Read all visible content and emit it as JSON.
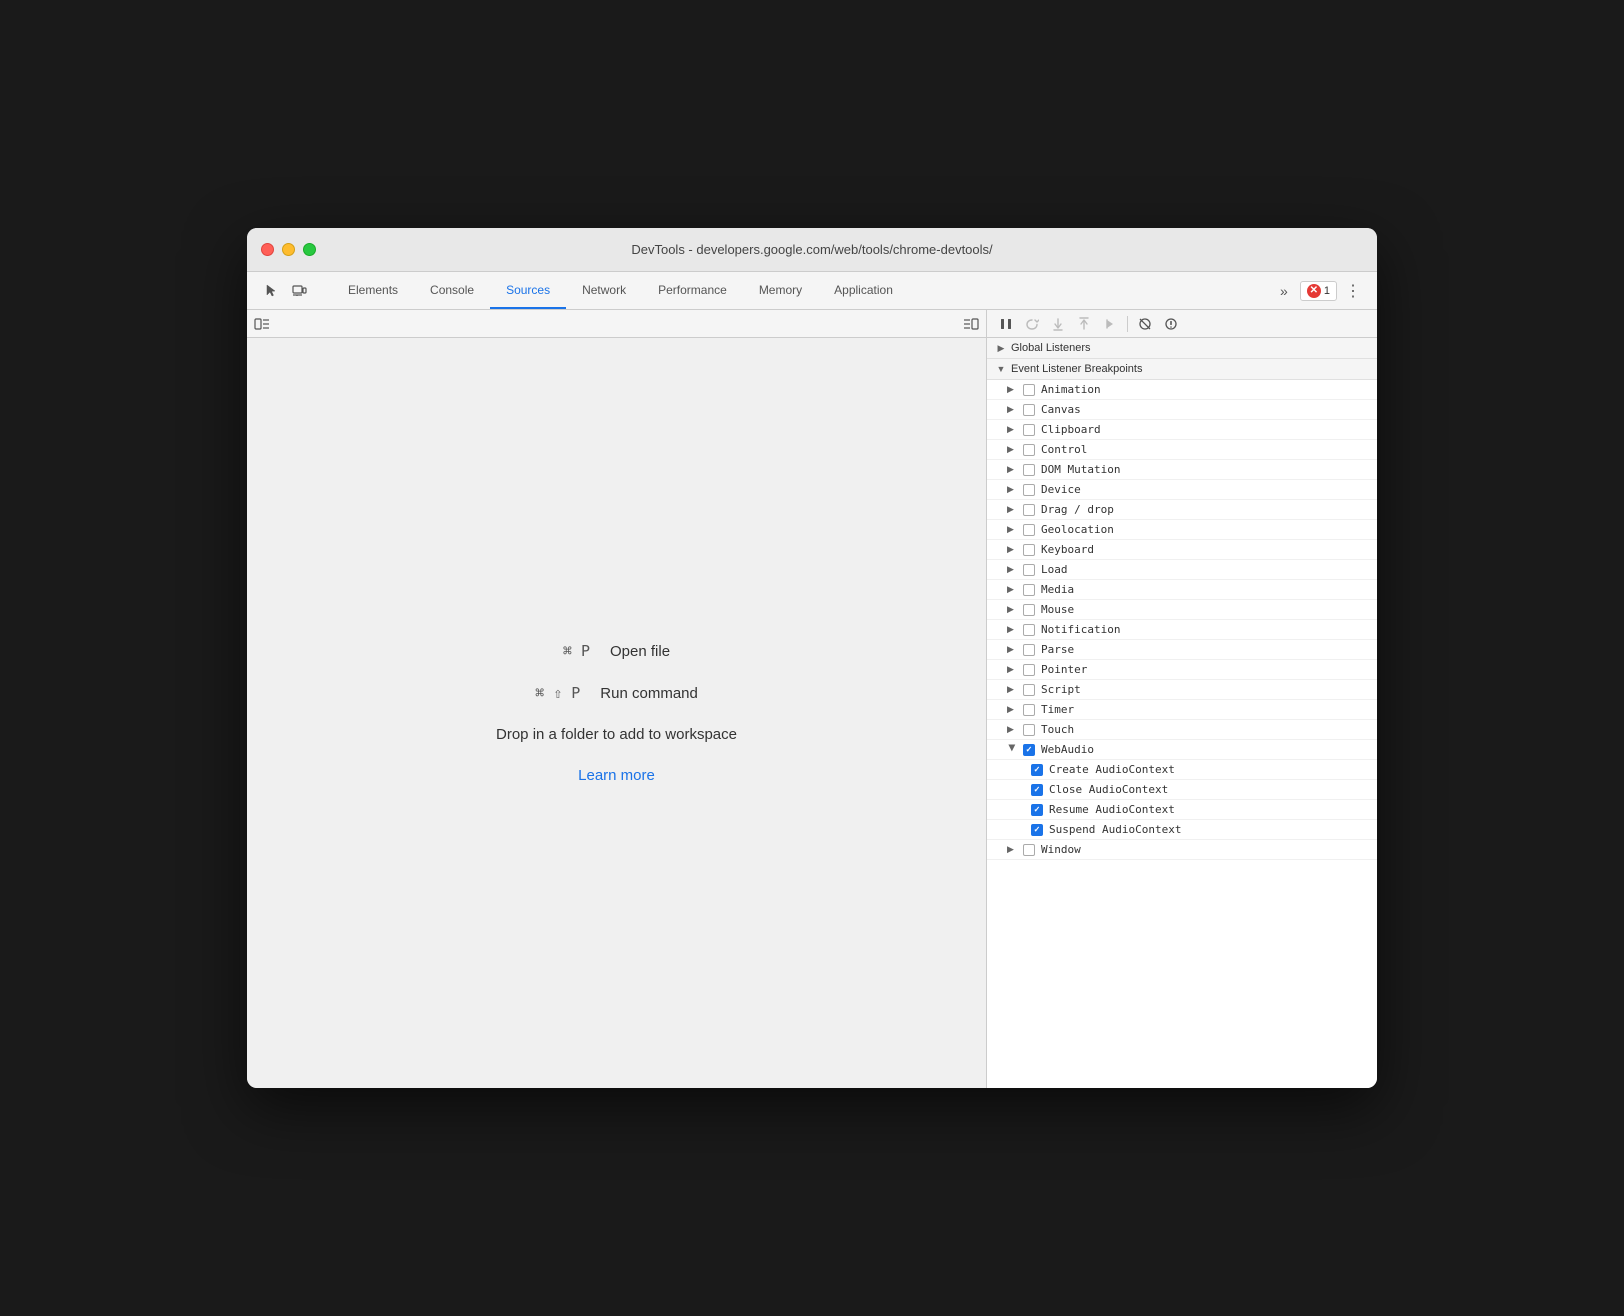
{
  "window": {
    "title": "DevTools - developers.google.com/web/tools/chrome-devtools/"
  },
  "tabs": {
    "items": [
      {
        "id": "elements",
        "label": "Elements",
        "active": false
      },
      {
        "id": "console",
        "label": "Console",
        "active": false
      },
      {
        "id": "sources",
        "label": "Sources",
        "active": true
      },
      {
        "id": "network",
        "label": "Network",
        "active": false
      },
      {
        "id": "performance",
        "label": "Performance",
        "active": false
      },
      {
        "id": "memory",
        "label": "Memory",
        "active": false
      },
      {
        "id": "application",
        "label": "Application",
        "active": false
      }
    ],
    "more_label": "»",
    "error_count": "1",
    "more_options_label": "⋮"
  },
  "sources_panel": {
    "shortcut_open_file": "⌘ P",
    "label_open_file": "Open file",
    "shortcut_run_command": "⌘ ⇧ P",
    "label_run_command": "Run command",
    "drop_text": "Drop in a folder to add to workspace",
    "learn_more": "Learn more"
  },
  "debugger_toolbar": {
    "buttons": [
      {
        "id": "pause",
        "icon": "⏸",
        "label": "Pause/Resume",
        "disabled": false
      },
      {
        "id": "step-over",
        "icon": "↺",
        "label": "Step over",
        "disabled": true
      },
      {
        "id": "step-into",
        "icon": "↓",
        "label": "Step into",
        "disabled": true
      },
      {
        "id": "step-out",
        "icon": "↑",
        "label": "Step out",
        "disabled": true
      },
      {
        "id": "step",
        "icon": "→",
        "label": "Step",
        "disabled": true
      }
    ]
  },
  "breakpoints": {
    "global_listeners_label": "Global Listeners",
    "event_listener_label": "Event Listener Breakpoints",
    "items": [
      {
        "id": "animation",
        "label": "Animation",
        "checked": false,
        "expanded": false
      },
      {
        "id": "canvas",
        "label": "Canvas",
        "checked": false,
        "expanded": false
      },
      {
        "id": "clipboard",
        "label": "Clipboard",
        "checked": false,
        "expanded": false
      },
      {
        "id": "control",
        "label": "Control",
        "checked": false,
        "expanded": false
      },
      {
        "id": "dom-mutation",
        "label": "DOM Mutation",
        "checked": false,
        "expanded": false
      },
      {
        "id": "device",
        "label": "Device",
        "checked": false,
        "expanded": false
      },
      {
        "id": "drag-drop",
        "label": "Drag / drop",
        "checked": false,
        "expanded": false
      },
      {
        "id": "geolocation",
        "label": "Geolocation",
        "checked": false,
        "expanded": false
      },
      {
        "id": "keyboard",
        "label": "Keyboard",
        "checked": false,
        "expanded": false
      },
      {
        "id": "load",
        "label": "Load",
        "checked": false,
        "expanded": false
      },
      {
        "id": "media",
        "label": "Media",
        "checked": false,
        "expanded": false
      },
      {
        "id": "mouse",
        "label": "Mouse",
        "checked": false,
        "expanded": false
      },
      {
        "id": "notification",
        "label": "Notification",
        "checked": false,
        "expanded": false
      },
      {
        "id": "parse",
        "label": "Parse",
        "checked": false,
        "expanded": false
      },
      {
        "id": "pointer",
        "label": "Pointer",
        "checked": false,
        "expanded": false
      },
      {
        "id": "script",
        "label": "Script",
        "checked": false,
        "expanded": false
      },
      {
        "id": "timer",
        "label": "Timer",
        "checked": false,
        "expanded": false
      },
      {
        "id": "touch",
        "label": "Touch",
        "checked": false,
        "expanded": false
      },
      {
        "id": "webaudio",
        "label": "WebAudio",
        "checked": true,
        "expanded": true
      },
      {
        "id": "window",
        "label": "Window",
        "checked": false,
        "expanded": false
      }
    ],
    "webaudio_children": [
      {
        "id": "create-audio",
        "label": "Create AudioContext",
        "checked": true
      },
      {
        "id": "close-audio",
        "label": "Close AudioContext",
        "checked": true
      },
      {
        "id": "resume-audio",
        "label": "Resume AudioContext",
        "checked": true
      },
      {
        "id": "suspend-audio",
        "label": "Suspend AudioContext",
        "checked": true
      }
    ],
    "colors": {
      "checked": "#1a73e8"
    }
  }
}
